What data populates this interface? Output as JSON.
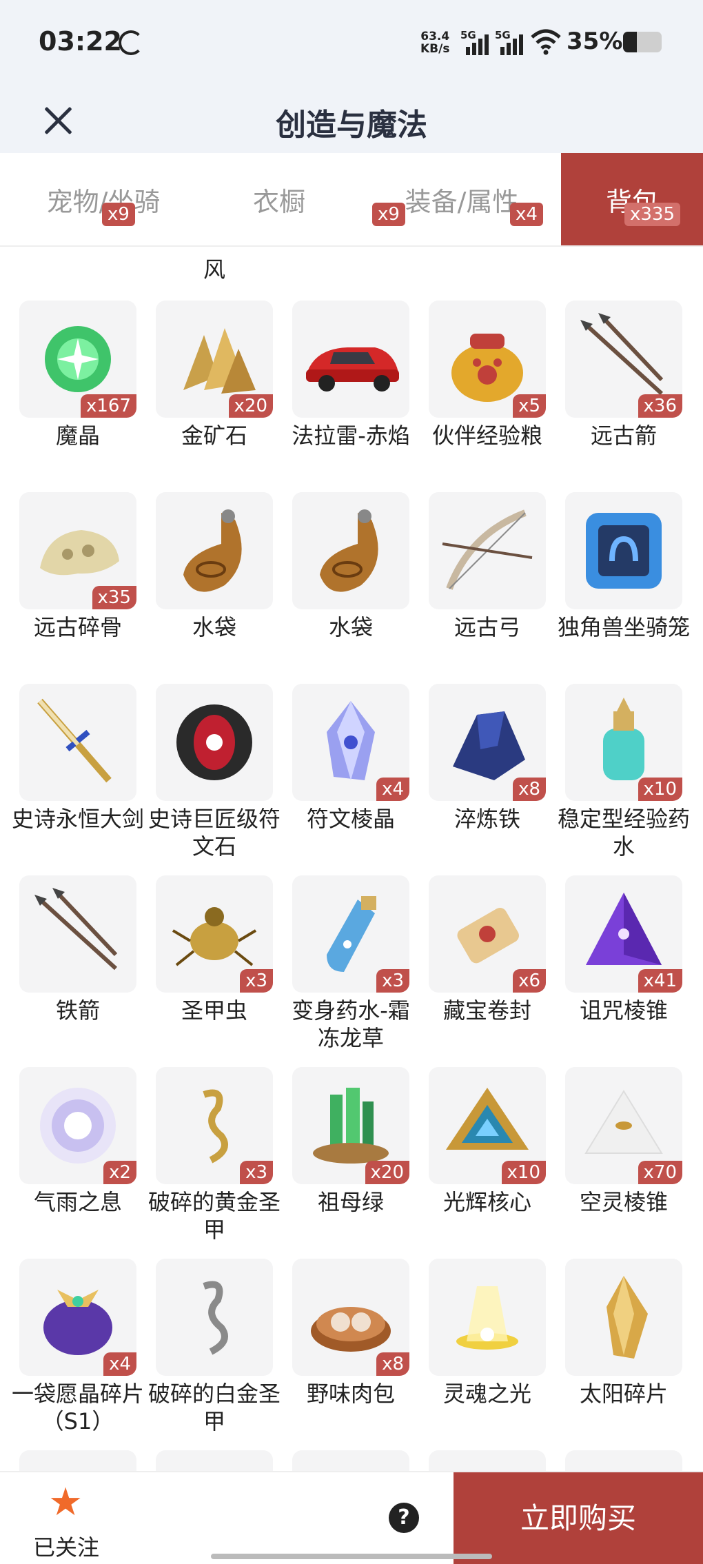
{
  "status": {
    "time": "03:22",
    "net_speed": "63.4",
    "net_unit": "KB/s",
    "sig1": "5G",
    "sig2": "5G",
    "battery": "35%",
    "battery_level": 0.35
  },
  "header": {
    "title": "创造与魔法"
  },
  "tabs": [
    {
      "label": "宠物/坐骑",
      "count": "x9",
      "active": false
    },
    {
      "label": "衣橱",
      "count": "x9",
      "active": false
    },
    {
      "label": "装备/属性",
      "count": "x4",
      "active": false
    },
    {
      "label": "背包",
      "count": "x335",
      "active": true
    }
  ],
  "prev_row": [
    "",
    "风",
    "",
    "",
    ""
  ],
  "items": [
    {
      "name": "魔晶",
      "qty": "x167",
      "icon": "green-crystal-orb-icon"
    },
    {
      "name": "金矿石",
      "qty": "x20",
      "icon": "gold-ore-icon"
    },
    {
      "name": "法拉雷-赤焰",
      "qty": "",
      "icon": "red-car-icon"
    },
    {
      "name": "伙伴经验粮",
      "qty": "x5",
      "icon": "food-sack-icon"
    },
    {
      "name": "远古箭",
      "qty": "x36",
      "icon": "crossed-arrows-icon"
    },
    {
      "name": "远古碎骨",
      "qty": "x35",
      "icon": "bone-fragment-icon"
    },
    {
      "name": "水袋",
      "qty": "",
      "icon": "water-bag-icon"
    },
    {
      "name": "水袋",
      "qty": "",
      "icon": "water-bag-icon"
    },
    {
      "name": "远古弓",
      "qty": "",
      "icon": "bow-icon"
    },
    {
      "name": "独角兽坐骑笼",
      "qty": "",
      "icon": "unicorn-cage-icon"
    },
    {
      "name": "史诗永恒大剑",
      "qty": "",
      "icon": "greatsword-icon"
    },
    {
      "name": "史诗巨匠级符文石",
      "qty": "",
      "icon": "rune-stone-icon"
    },
    {
      "name": "符文棱晶",
      "qty": "x4",
      "icon": "rune-prism-icon"
    },
    {
      "name": "淬炼铁",
      "qty": "x8",
      "icon": "refined-iron-icon"
    },
    {
      "name": "稳定型经验药水",
      "qty": "x10",
      "icon": "potion-bottle-icon"
    },
    {
      "name": "铁箭",
      "qty": "",
      "icon": "crossed-arrows-icon"
    },
    {
      "name": "圣甲虫",
      "qty": "x3",
      "icon": "scarab-icon"
    },
    {
      "name": "变身药水-霜冻龙草",
      "qty": "x3",
      "icon": "frost-potion-icon"
    },
    {
      "name": "藏宝卷封",
      "qty": "x6",
      "icon": "scroll-icon"
    },
    {
      "name": "诅咒棱锥",
      "qty": "x41",
      "icon": "purple-pyramid-icon"
    },
    {
      "name": "气雨之息",
      "qty": "x2",
      "icon": "glowing-orb-icon"
    },
    {
      "name": "破碎的黄金圣甲",
      "qty": "x3",
      "icon": "golden-shard-icon"
    },
    {
      "name": "祖母绿",
      "qty": "x20",
      "icon": "emerald-icon"
    },
    {
      "name": "光辉核心",
      "qty": "x10",
      "icon": "radiant-core-icon"
    },
    {
      "name": "空灵棱锥",
      "qty": "x70",
      "icon": "white-pyramid-icon"
    },
    {
      "name": "一袋愿晶碎片（S1）",
      "qty": "x4",
      "icon": "crystal-bag-icon"
    },
    {
      "name": "破碎的白金圣甲",
      "qty": "",
      "icon": "platinum-shard-icon"
    },
    {
      "name": "野味肉包",
      "qty": "x8",
      "icon": "steamed-bun-icon"
    },
    {
      "name": "灵魂之光",
      "qty": "",
      "icon": "soul-light-icon"
    },
    {
      "name": "太阳碎片",
      "qty": "",
      "icon": "sun-shard-icon"
    }
  ],
  "footer": {
    "follow_label": "已关注",
    "help": "?",
    "buy_label": "立即购买"
  }
}
